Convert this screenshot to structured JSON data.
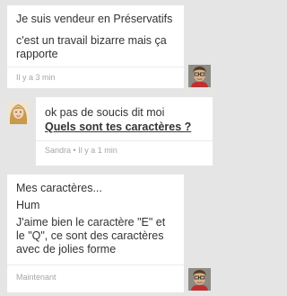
{
  "messages": [
    {
      "lines": [
        "Je suis vendeur en Préservatifs",
        "c'est un travail bizarre mais ça",
        "rapporte"
      ],
      "timestamp": "Il y a 3 min",
      "avatar": "user-avatar-man-glasses"
    },
    {
      "lines": [
        "ok pas de soucis dit  moi"
      ],
      "link": "Quels sont tes caractères ?",
      "sender": "Sandra",
      "separator": " • ",
      "timestamp": "Il y a 1 min",
      "avatar": "sandra-avatar-woman"
    },
    {
      "lines": [
        "Mes caractères...",
        "Hum",
        "J'aime bien le caractère \"E\" et",
        "le \"Q\", ce sont des caractères",
        "avec de jolies forme"
      ],
      "timestamp": "Maintenant",
      "avatar": "user-avatar-man-glasses"
    }
  ],
  "colors": {
    "background": "#e5e5e5",
    "bubble": "#ffffff",
    "text": "#333333",
    "meta": "#a6a6a6"
  }
}
